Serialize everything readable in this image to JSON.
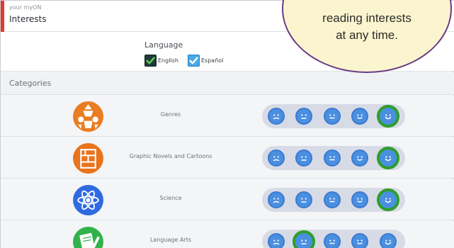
{
  "header": {
    "kicker": "your myON",
    "title": "Interests"
  },
  "language": {
    "label": "Language",
    "options": [
      {
        "label": "English",
        "checked": true
      },
      {
        "label": "Español",
        "checked": true
      }
    ]
  },
  "categories_label": "Categories",
  "categories": [
    {
      "name": "Genres",
      "icon": "genres-icon",
      "color": "#ea7d21",
      "rating": 5
    },
    {
      "name": "Graphic Novels and Cartoons",
      "icon": "comic-panel-icon",
      "color": "#e8741c",
      "rating": 5
    },
    {
      "name": "Science",
      "icon": "atom-icon",
      "color": "#2f6ae0",
      "rating": 5
    },
    {
      "name": "Language Arts",
      "icon": "pencil-paper-icon",
      "color": "#31b24a",
      "rating": 2
    }
  ],
  "rating_scale": [
    1,
    2,
    3,
    4,
    5
  ],
  "callout": {
    "line1": "reading interests",
    "line2": "at any time."
  },
  "colors": {
    "accent_red": "#e23b2e",
    "face_blue": "#4a8fe0",
    "selected_green": "#2e9e2a",
    "callout_border": "#6a3d86",
    "callout_fill": "#fbf5cf"
  }
}
